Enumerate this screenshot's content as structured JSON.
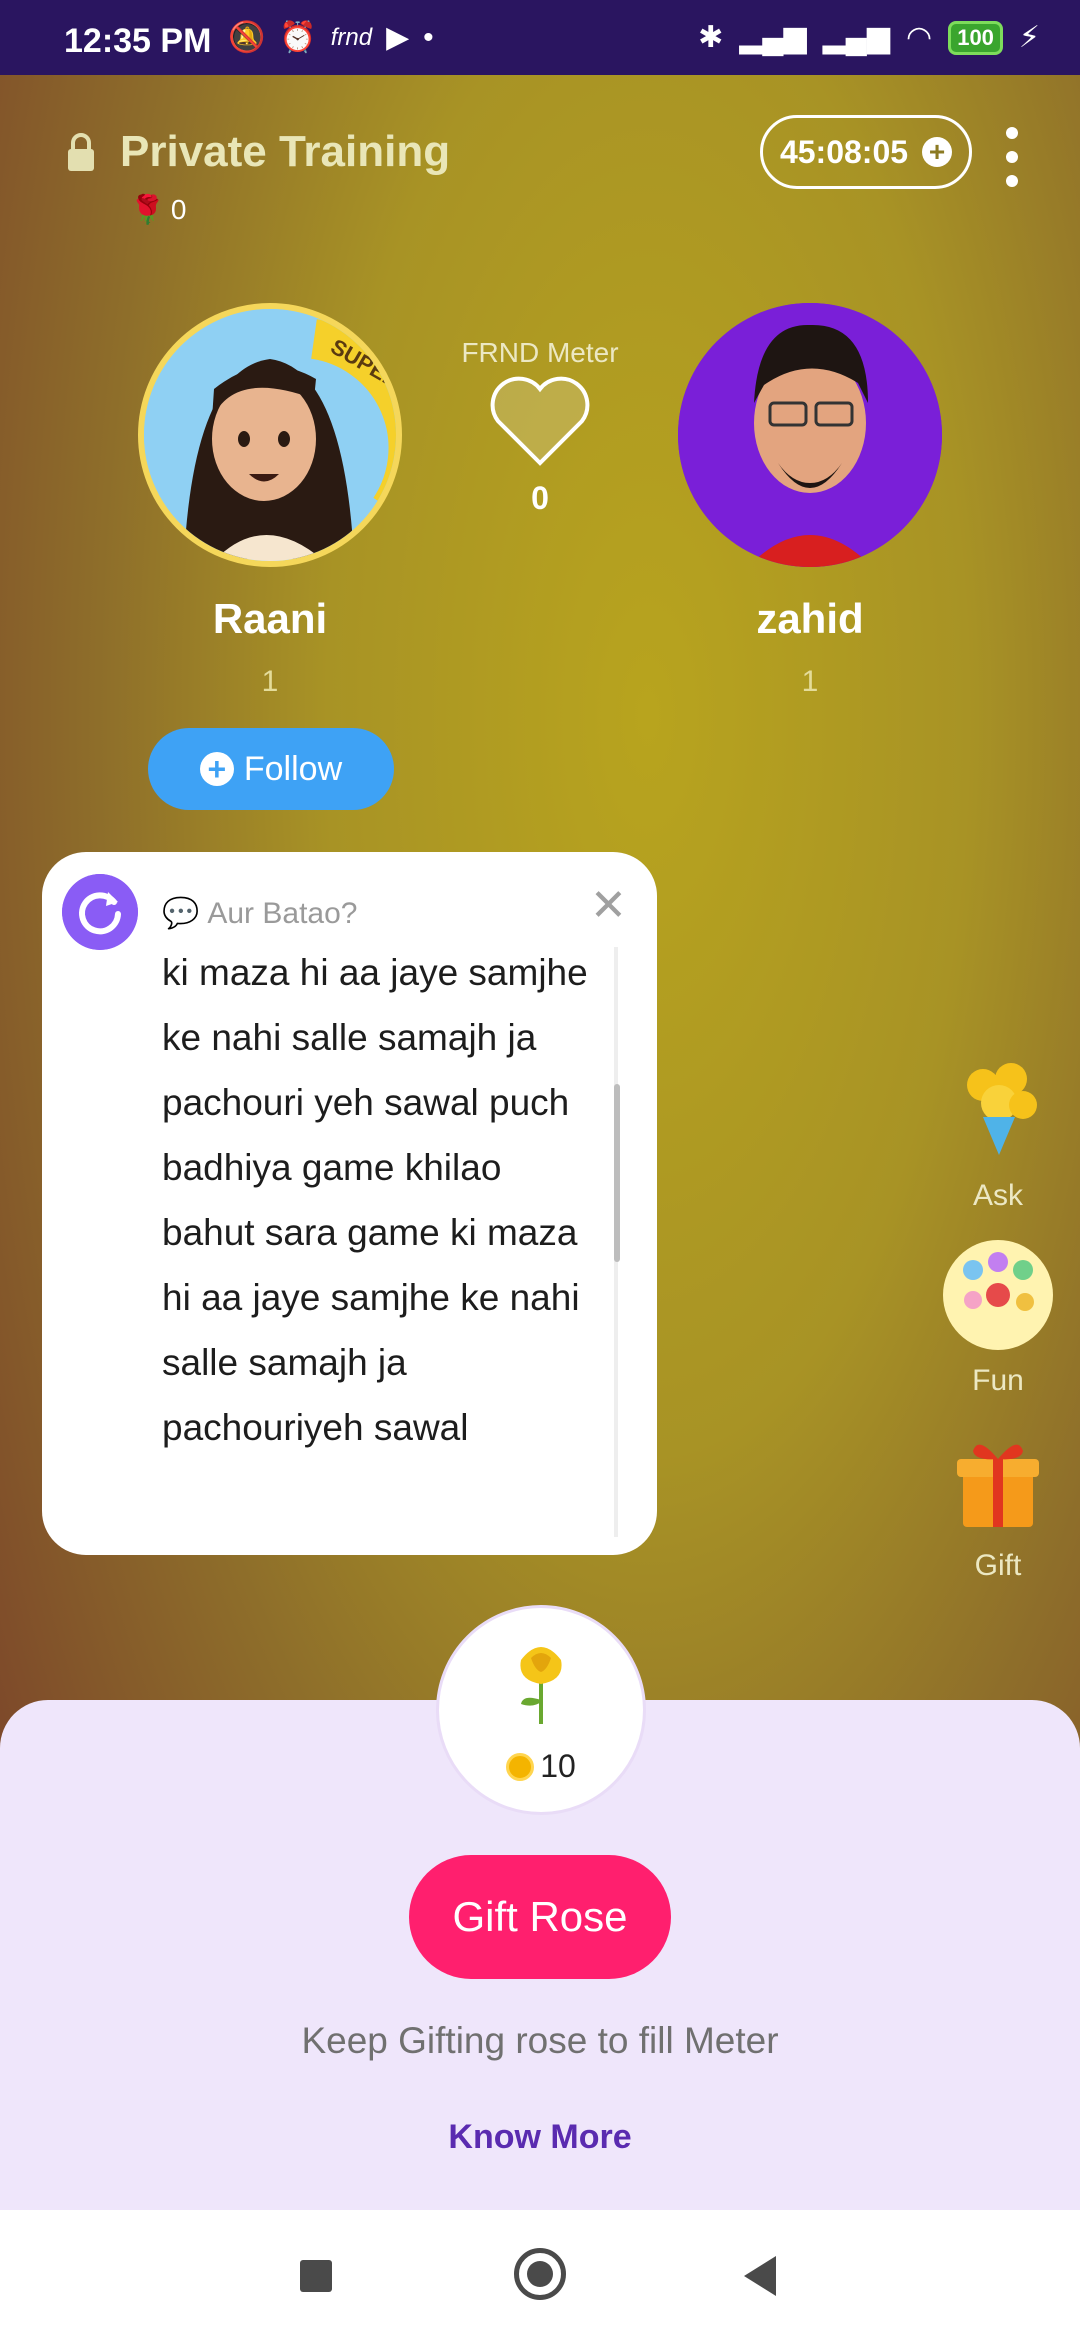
{
  "status_bar": {
    "time": "12:35 PM",
    "battery": "100",
    "notif_frnd": "frnd"
  },
  "room": {
    "title": "Private Training",
    "rose_count": "0",
    "timer": "45:08:05"
  },
  "users": [
    {
      "name": "Raani",
      "count": "1",
      "badge": "SUPER FRND"
    },
    {
      "name": "zahid",
      "count": "1"
    }
  ],
  "meter": {
    "label": "FRND Meter",
    "value": "0"
  },
  "follow_label": "Follow",
  "question": {
    "label": "Aur Batao?",
    "text": "ki maza hi aa jaye samjhe ke nahi salle samajh ja pachouri yeh sawal puch badhiya game khilao bahut sara game ki maza hi aa jaye samjhe ke nahi salle samajh ja pachouriyeh sawal"
  },
  "side_actions": [
    {
      "label": "Ask",
      "icon": "bouquet-icon"
    },
    {
      "label": "Fun",
      "icon": "lottery-balls-icon"
    },
    {
      "label": "Gift",
      "icon": "gift-box-icon"
    }
  ],
  "gift_sheet": {
    "price": "10",
    "button": "Gift Rose",
    "hint": "Keep Gifting rose to fill Meter",
    "know_more": "Know More"
  },
  "colors": {
    "accent_pink": "#ff1f6e",
    "follow_blue": "#3ea2f5",
    "purple": "#8a5cf5"
  }
}
